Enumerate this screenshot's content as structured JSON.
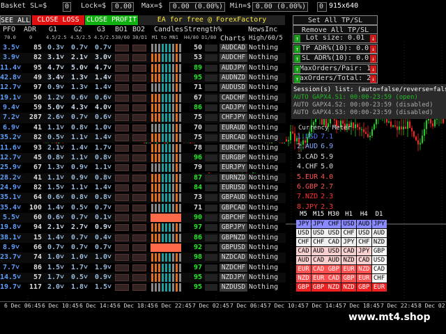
{
  "topbar": {
    "basket_sl_label": "Basket SL=$",
    "basket_sl_value": "0",
    "lock_label": "Lock=$",
    "lock_value": "0.00",
    "max_label": "Max=$",
    "max_value": "0.00 (0.00%)",
    "min_label": "Min=$",
    "min_value": "0.00 (0.00%)",
    "num_value": "0",
    "resolution": "915x640"
  },
  "buttons": {
    "see_all": "SEE ALL",
    "close_loss": "CLOSE LOSS",
    "close_profit": "CLOSE PROFIT",
    "ea_free": "EA for free @ ForexFactory",
    "set_all": "Set All TP/SL",
    "remove_all": "Remove All TP/SL"
  },
  "headers": {
    "pfo": "PFO",
    "adr": "ADR",
    "g1": "G1",
    "g2": "G2",
    "g3": "G3",
    "bo1": "BO1",
    "bo2": "BO2",
    "candles": "Candles",
    "strength": "Strength%",
    "charts": "Charts",
    "news": "NewsInc",
    "pfo_sub": "70.0",
    "adr_sub": "0",
    "g1_sub": "4.5/2.5",
    "g2_sub": "4.5/2.5",
    "g3_sub": "4.5/2.5",
    "bo1_sub": "30/60",
    "bo2_sub": "30/D1",
    "candles_sub": "M1 to MN1",
    "strength_sub": "H4/80 D1/80",
    "news_sub": "High/60/5"
  },
  "rows": [
    {
      "pfo": "3.5",
      "adr": "85",
      "g1": "0.3",
      "g2": "0.7",
      "g3": "0.7",
      "str": "50",
      "pair": "AUDCAD",
      "news": "Nothing",
      "gc": "#9bd",
      "bo": "#a88"
    },
    {
      "pfo": "3.9",
      "adr": "82",
      "g1": "3.1",
      "g2": "2.1",
      "g3": "3.0",
      "str": "53",
      "pair": "AUDCHF",
      "news": "Nothing",
      "gc": "#cde",
      "bo": "#a88"
    },
    {
      "pfo": "11.4",
      "adr": "95",
      "g1": "4.7",
      "g2": "5.0",
      "g3": "4.7",
      "str": "89",
      "pair": "AUDJPY",
      "news": "Nothing",
      "gc": "#cde",
      "bo": "#a88"
    },
    {
      "pfo": "42.8",
      "adr": "49",
      "g1": "3.4",
      "g2": "1.3",
      "g3": "1.4",
      "str": "95",
      "pair": "AUDNZD",
      "news": "Nothing",
      "gc": "#cde",
      "bo": "#a88"
    },
    {
      "pfo": "12.7",
      "adr": "97",
      "g1": "0.9",
      "g2": "1.3",
      "g3": "1.4",
      "str": "71",
      "pair": "AUDUSD",
      "news": "Nothing",
      "gc": "#9bd",
      "bo": "#a88"
    },
    {
      "pfo": "19.1",
      "adr": "50",
      "g1": "1.2",
      "g2": "0.6",
      "g3": "0.6",
      "str": "67",
      "pair": "CADCHF",
      "news": "Nothing",
      "gc": "#9bd",
      "bo": "#a88"
    },
    {
      "pfo": "9.4",
      "adr": "59",
      "g1": "5.0",
      "g2": "4.3",
      "g3": "4.0",
      "str": "86",
      "pair": "CADJPY",
      "news": "Nothing",
      "gc": "#cde",
      "bo": "#a88"
    },
    {
      "pfo": "7.2",
      "adr": "287",
      "g1": "2.6",
      "g2": "0.7",
      "g3": "0.6",
      "str": "75",
      "pair": "CHFJPY",
      "news": "Nothing",
      "gc": "#9bd",
      "bo": "#a88"
    },
    {
      "pfo": "6.9",
      "adr": "41",
      "g1": "1.1",
      "g2": "0.8",
      "g3": "1.0",
      "str": "70",
      "pair": "EURAUD",
      "news": "Nothing",
      "gc": "#9bd",
      "bo": "#a88"
    },
    {
      "pfo": "35.2",
      "adr": "82",
      "g1": "0.5",
      "g2": "1.1",
      "g3": "1.4",
      "str": "75",
      "pair": "EURCAD",
      "news": "Nothing",
      "gc": "#9bd",
      "bo": "#a88"
    },
    {
      "pfo": "11.6",
      "adr": "93",
      "g1": "2.1",
      "g2": "1.4",
      "g3": "1.7",
      "str": "78",
      "pair": "EURCHF",
      "news": "Nothing",
      "gc": "#9bd",
      "bo": "#a88"
    },
    {
      "pfo": "12.7",
      "adr": "45",
      "g1": "0.8",
      "g2": "1.1",
      "g3": "0.8",
      "str": "96",
      "pair": "EURGBP",
      "news": "Nothing",
      "gc": "#9bd",
      "bo": "#a88"
    },
    {
      "pfo": "25.9",
      "adr": "67",
      "g1": "1.3",
      "g2": "0.9",
      "g3": "1.1",
      "str": "79",
      "pair": "EURJPY",
      "news": "Nothing",
      "gc": "#9bd",
      "bo": "#a88"
    },
    {
      "pfo": "28.2",
      "adr": "41",
      "g1": "1.1",
      "g2": "0.9",
      "g3": "0.8",
      "str": "87",
      "pair": "EURNZD",
      "news": "Nothing",
      "gc": "#9bd",
      "bo": "#a88"
    },
    {
      "pfo": "24.9",
      "adr": "82",
      "g1": "1.5",
      "g2": "1.1",
      "g3": "1.4",
      "str": "84",
      "pair": "EURUSD",
      "news": "Nothing",
      "gc": "#9bd",
      "bo": "#a88"
    },
    {
      "pfo": "35.1",
      "adr": "64",
      "g1": "0.6",
      "g2": "0.8",
      "g3": "0.8",
      "str": "73",
      "pair": "GBPAUD",
      "news": "Nothing",
      "gc": "#9bd",
      "bo": "#a88"
    },
    {
      "pfo": "35.4",
      "adr": "100",
      "g1": "1.4",
      "g2": "0.5",
      "g3": "0.7",
      "str": "71",
      "pair": "GBPCAD",
      "news": "Nothing",
      "gc": "#9bd",
      "bo": "#a88"
    },
    {
      "pfo": "5.5",
      "adr": "60",
      "g1": "0.6",
      "g2": "0.7",
      "g3": "0.1",
      "str": "90",
      "pair": "GBPCHF",
      "news": "Nothing",
      "gc": "#9bd",
      "bo": "#a88",
      "alert": true
    },
    {
      "pfo": "19.8",
      "adr": "94",
      "g1": "2.1",
      "g2": "2.7",
      "g3": "0.9",
      "str": "97",
      "pair": "GBPJPY",
      "news": "Nothing",
      "gc": "#cde",
      "bo": "#a88"
    },
    {
      "pfo": "38.1",
      "adr": "15",
      "g1": "1.4",
      "g2": "0.7",
      "g3": "0.4",
      "str": "86",
      "pair": "GBPNZD",
      "news": "Nothing",
      "gc": "#9bd",
      "bo": "#a88"
    },
    {
      "pfo": "8.9",
      "adr": "66",
      "g1": "0.7",
      "g2": "0.7",
      "g3": "0.7",
      "str": "92",
      "pair": "GBPUSD",
      "news": "Nothing",
      "gc": "#9bd",
      "bo": "#a88",
      "alert": true
    },
    {
      "pfo": "23.7",
      "adr": "74",
      "g1": "1.0",
      "g2": "1.0",
      "g3": "1.0",
      "str": "98",
      "pair": "NZDCAD",
      "news": "Nothing",
      "gc": "#9bd",
      "bo": "#a88"
    },
    {
      "pfo": "7.7",
      "adr": "86",
      "g1": "1.5",
      "g2": "1.7",
      "g3": "1.9",
      "str": "97",
      "pair": "NZDCHF",
      "news": "Nothing",
      "gc": "#9bd",
      "bo": "#a88"
    },
    {
      "pfo": "14.5",
      "adr": "57",
      "g1": "1.7",
      "g2": "0.5",
      "g3": "0.9",
      "str": "95",
      "pair": "NZDJPY",
      "news": "Nothing",
      "gc": "#9bd",
      "bo": "#a88"
    },
    {
      "pfo": "19.7",
      "adr": "117",
      "g1": "2.0",
      "g2": "1.8",
      "g3": "1.5",
      "str": "95",
      "pair": "NZDUSD",
      "news": "Nothing",
      "gc": "#9bd",
      "bo": "#a88"
    }
  ],
  "settings": {
    "lot_size": "Lot size: 0.01",
    "tp_adr": "TP ADR%(10): 0.0",
    "sl_adr": "SL ADR%(10): 0.0",
    "max_orders_pair": "MaxOrders/Pair: 1",
    "max_orders_total": "MaxOrders/Total: 28"
  },
  "sessions": {
    "title": "Session(s) list: (auto=false/reverse=false)",
    "s1": "AUTO GAPX4.S1: 00:00-23:59 (open)",
    "s2": "AUTO GAPX4.S2: 00:00-23:59 (disabled)",
    "s3": "AUTO GAPX4.S3: 00:00-23:59 (disabled)"
  },
  "currency_meter": {
    "title": "Currency Meter",
    "items": [
      {
        "rank": "1.USD",
        "value": "7.1",
        "color": "#5577ff"
      },
      {
        "rank": "2.AUD",
        "value": "6.9",
        "color": "#88aaff"
      },
      {
        "rank": "3.CAD",
        "value": "5.9",
        "color": "#dddddd"
      },
      {
        "rank": "4.CHF",
        "value": "5.0",
        "color": "#dddddd"
      },
      {
        "rank": "5.EUR",
        "value": "4.0",
        "color": "#ff5555"
      },
      {
        "rank": "6.GBP",
        "value": "2.7",
        "color": "#ff5555"
      },
      {
        "rank": "7.NZD",
        "value": "2.3",
        "color": "#ff3333"
      },
      {
        "rank": "8.JPY",
        "value": "2.3",
        "color": "#ff3333"
      }
    ]
  },
  "timeframes": [
    "M5",
    "M15",
    "M30",
    "H1",
    "H4",
    "D1"
  ],
  "tf_grid": [
    [
      "JPY",
      "JPY",
      "CHF",
      "USD",
      "AUD",
      "JPY"
    ],
    [
      "USD",
      "USD",
      "USD",
      "CHF",
      "USD",
      "AUD"
    ],
    [
      "CHF",
      "CHF",
      "CAD",
      "JPY",
      "CHF",
      "NZD"
    ],
    [
      "CAD",
      "AUD",
      "USD",
      "CAD",
      "JPY",
      "GBP"
    ],
    [
      "AUD",
      "CAD",
      "AUD",
      "NZD",
      "CAD",
      "USD"
    ],
    [
      "EUR",
      "CAD",
      "GBP",
      "EUR",
      "NZD",
      "CAD"
    ],
    [
      "NZD",
      "EUR",
      "CAD",
      "GBP",
      "EUR",
      "CHF"
    ],
    [
      "GBP",
      "GBP",
      "NZD",
      "NZD",
      "GBP",
      "EUR"
    ]
  ],
  "xaxis": [
    "6 Dec 06:45",
    "6 Dec 10:45",
    "6 Dec 14:45",
    "6 Dec 18:45",
    "6 Dec 22:45",
    "7 Dec 02:45",
    "7 Dec 06:45",
    "7 Dec 10:45",
    "7 Dec 14:45",
    "7 Dec 18:45",
    "7 Dec 22:45",
    "8 Dec 02"
  ],
  "watermark": "www.mt4.shop",
  "colors": {
    "buy_green": "#22cc22",
    "sell_red": "#ff2222",
    "accent_blue": "#5577ff"
  }
}
